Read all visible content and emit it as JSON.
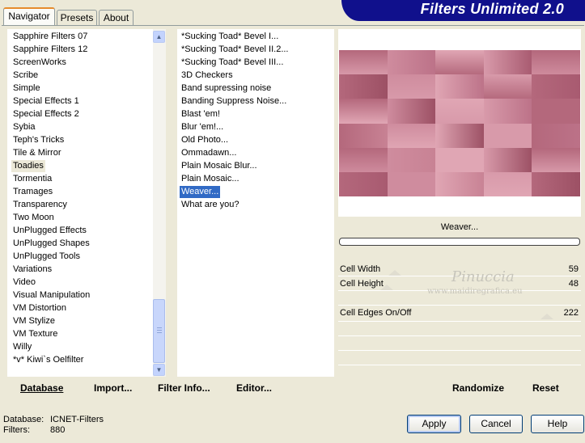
{
  "header": {
    "title": "Filters Unlimited 2.0"
  },
  "tabs": [
    {
      "label": "Navigator",
      "active": true
    },
    {
      "label": "Presets",
      "active": false
    },
    {
      "label": "About",
      "active": false
    }
  ],
  "categories": {
    "selected": "Toadies",
    "items": [
      "Sapphire Filters 07",
      "Sapphire Filters 12",
      "ScreenWorks",
      "Scribe",
      "Simple",
      "Special Effects 1",
      "Special Effects 2",
      "Sybia",
      "Teph's Tricks",
      "Tile & Mirror",
      "Toadies",
      "Tormentia",
      "Tramages",
      "Transparency",
      "Two Moon",
      "UnPlugged Effects",
      "UnPlugged Shapes",
      "UnPlugged Tools",
      "Variations",
      "Video",
      "Visual Manipulation",
      "VM Distortion",
      "VM Stylize",
      "VM Texture",
      "Willy",
      "*v* Kiwi`s Oelfilter"
    ]
  },
  "filters": {
    "selected": "Weaver...",
    "items": [
      "*Sucking Toad*  Bevel I...",
      "*Sucking Toad*  Bevel II.2...",
      "*Sucking Toad*  Bevel III...",
      "3D Checkers",
      "Band supressing noise",
      "Banding Suppress Noise...",
      "Blast 'em!",
      "Blur 'em!...",
      "Old Photo...",
      "Ommadawn...",
      "Plain Mosaic Blur...",
      "Plain Mosaic...",
      "Weaver...",
      "What are you?"
    ]
  },
  "left_bar": {
    "database_label": "Database",
    "import_label": "Import...",
    "filter_info_label": "Filter Info...",
    "editor_label": "Editor..."
  },
  "right_bar": {
    "randomize_label": "Randomize",
    "reset_label": "Reset"
  },
  "preview": {
    "filter_name": "Weaver...",
    "colors": [
      "#b4687c",
      "#c88294",
      "#d89aaa",
      "#a85a70",
      "#e0a6b4",
      "#bc7288",
      "#cf8c9e",
      "#9c5064"
    ]
  },
  "params": [
    {
      "label": "Cell Width",
      "value": "59"
    },
    {
      "label": "Cell Height",
      "value": "48"
    },
    {
      "label": "Cell Edges On/Off",
      "value": "222"
    }
  ],
  "watermark": {
    "name": "Pinuccia",
    "url": "www.maidiregrafica.eu"
  },
  "footer": {
    "database_key": "Database:",
    "database_value": "ICNET-Filters",
    "filters_key": "Filters:",
    "filters_value": "880",
    "apply_label": "Apply",
    "cancel_label": "Cancel",
    "help_label": "Help"
  },
  "icons": {
    "scroll_up": "scroll-up-icon",
    "scroll_down": "scroll-down-icon"
  }
}
